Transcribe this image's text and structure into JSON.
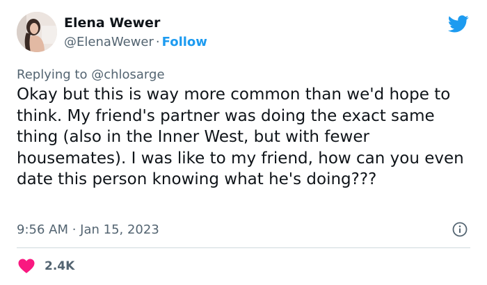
{
  "author": {
    "display_name": "Elena Wewer",
    "handle": "@ElenaWewer",
    "separator": "·",
    "follow_label": "Follow"
  },
  "reply_context": {
    "prefix": "Replying to ",
    "mention": "@chlosarge"
  },
  "tweet": {
    "text": "Okay but this is way more common than we'd hope to think. My friend's partner was doing the exact same thing (also in the Inner West, but with fewer housemates). I was like to my friend, how can you even date this person knowing what he's doing???",
    "timestamp": "9:56 AM · Jan 15, 2023",
    "like_count": "2.4K"
  },
  "icons": {
    "logo": "twitter-bird-icon",
    "info": "info-icon",
    "like": "heart-icon"
  },
  "colors": {
    "accent": "#1d9bf0",
    "like": "#f91880",
    "secondary_text": "#536471",
    "primary_text": "#0f1419",
    "divider": "#cfd9de"
  }
}
